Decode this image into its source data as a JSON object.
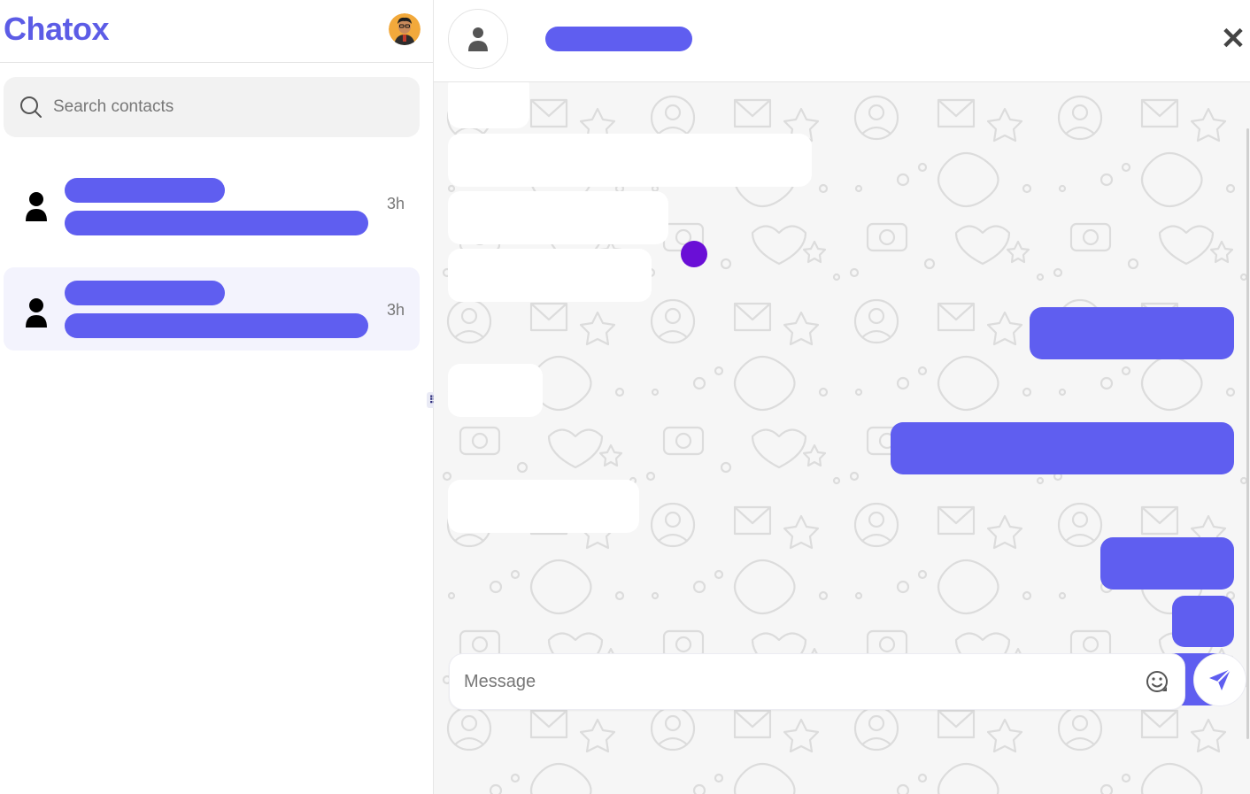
{
  "app": {
    "brand": "Chatox"
  },
  "search": {
    "placeholder": "Search contacts"
  },
  "contacts": [
    {
      "time": "3h",
      "active": false
    },
    {
      "time": "3h",
      "active": true
    }
  ],
  "chat": {
    "composer": {
      "placeholder": "Message"
    }
  },
  "icons": {
    "search": "search-icon",
    "contact": "user-icon",
    "close": "close-icon",
    "emoji": "emoji-icon",
    "send": "send-icon",
    "resize": "drag-handle-icon"
  },
  "colors": {
    "accent": "#5f5ef0",
    "brand": "#5c5ce6",
    "typing_dot": "#6a0fd6",
    "chat_background": "#f6f6f6"
  }
}
